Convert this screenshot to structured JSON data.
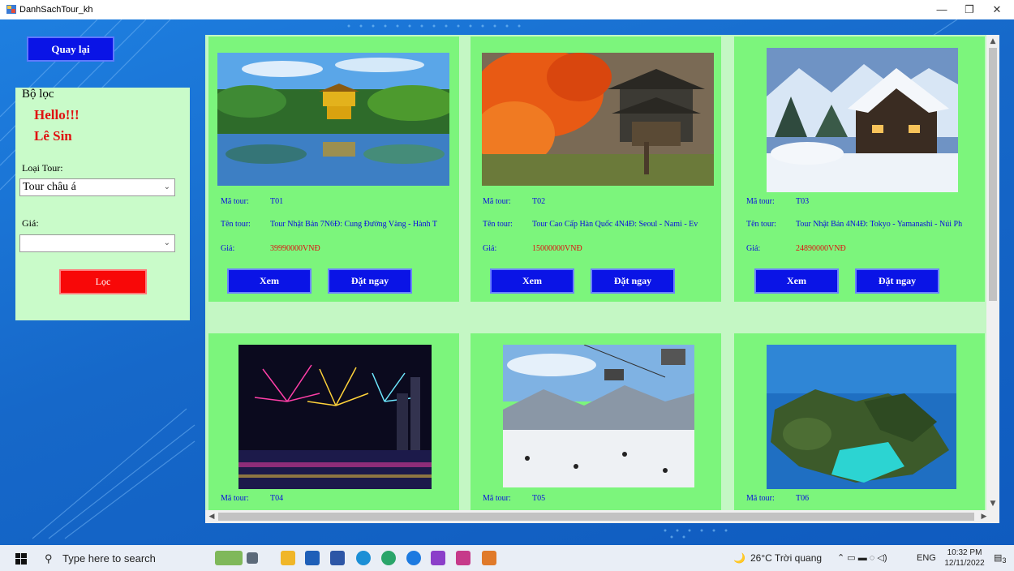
{
  "window": {
    "title": "DanhSachTour_kh",
    "minimize": "—",
    "maximize": "❐",
    "close": "✕"
  },
  "back_button": "Quay lại",
  "filter": {
    "title": "Bộ lọc",
    "hello": "Hello!!!",
    "user_name": "Lê Sin",
    "tour_type_label": "Loại Tour:",
    "tour_type_value": "Tour châu á",
    "price_label": "Giá:",
    "price_value": "",
    "filter_button": "Lọc"
  },
  "labels": {
    "code": "Mã tour:",
    "name": "Tên tour:",
    "price": "Giá:",
    "view": "Xem",
    "book": "Đặt ngay"
  },
  "tours": [
    {
      "code": "T01",
      "name": "Tour Nhật Bản 7N6Đ: Cung Đường Vàng - Hành T",
      "price": "39990000VNĐ",
      "image": "golden-pavilion-photo"
    },
    {
      "code": "T02",
      "name": "Tour Cao Cấp Hàn Quốc 4N4Đ: Seoul - Nami - Ev",
      "price": "15000000VNĐ",
      "image": "autumn-palace-photo"
    },
    {
      "code": "T03",
      "name": "Tour Nhật Bản 4N4Đ: Tokyo - Yamanashi - Núi Ph",
      "price": "24890000VNĐ",
      "image": "snow-village-photo"
    },
    {
      "code": "T04",
      "name": "",
      "price": "",
      "image": "fireworks-photo"
    },
    {
      "code": "T05",
      "name": "",
      "price": "",
      "image": "ski-resort-photo"
    },
    {
      "code": "T06",
      "name": "",
      "price": "",
      "image": "tropical-island-photo"
    }
  ],
  "taskbar": {
    "search_placeholder": "Type here to search",
    "weather": "26°C  Trời quang",
    "language": "ENG",
    "time": "10:32 PM",
    "date": "12/11/2022",
    "notifications": "3"
  },
  "colors": {
    "card": "#7cf57c",
    "button": "#0a14e6",
    "filter_button": "#f80808",
    "accent_red": "#e01010"
  }
}
